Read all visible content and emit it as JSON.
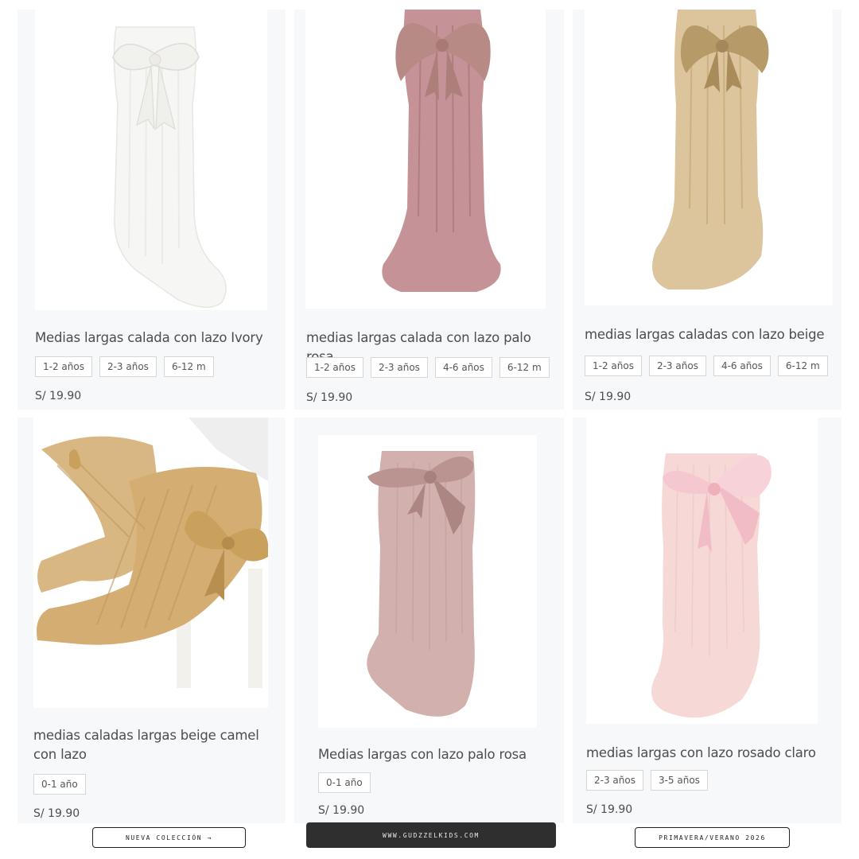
{
  "products": [
    {
      "title": "Medias largas calada con lazo Ivory",
      "sizes": [
        "1-2 años",
        "2-3 años",
        "6-12 m"
      ],
      "price": "S/ 19.90",
      "sock_color": "#f6f6f4",
      "bow_color": "#f1f1ee",
      "image_icon": "white-knee-sock-with-bow"
    },
    {
      "title": "medias largas calada con lazo palo rosa",
      "sizes": [
        "1-2 años",
        "2-3 años",
        "4-6 años",
        "6-12 m"
      ],
      "price": "S/ 19.90",
      "sock_color": "#c59397",
      "bow_color": "#b88a86",
      "image_icon": "pink-openwork-sock-with-bow"
    },
    {
      "title": "medias largas caladas con lazo beige",
      "sizes": [
        "1-2 años",
        "2-3 años",
        "4-6 años",
        "6-12 m"
      ],
      "price": "S/ 19.90",
      "sock_color": "#dcc49c",
      "bow_color": "#b69a68",
      "image_icon": "beige-openwork-sock-with-bow"
    },
    {
      "title": "medias caladas largas beige camel con lazo",
      "sizes": [
        "0-1 año"
      ],
      "price": "S/ 19.90",
      "sock_color": "#d9b782",
      "bow_color": "#c9a05c",
      "image_icon": "camel-socks-on-baby-legs"
    },
    {
      "title": "Medias largas con lazo palo rosa",
      "sizes": [
        "0-1 año"
      ],
      "price": "S/ 19.90",
      "sock_color": "#d2b0ae",
      "bow_color": "#b99491",
      "image_icon": "dusty-pink-sock-with-bow"
    },
    {
      "title": "medias largas con lazo rosado claro",
      "sizes": [
        "2-3 años",
        "3-5 años"
      ],
      "price": "S/ 19.90",
      "sock_color": "#f6d8d6",
      "bow_color": "#f5c7cf",
      "image_icon": "light-pink-sock-with-satin-bow"
    }
  ],
  "footer": {
    "left": "NUEVA COLECCIÓN →",
    "center": "WWW.GUDZZELKIDS.COM",
    "right": "PRIMAVERA/VERANO 2026"
  }
}
